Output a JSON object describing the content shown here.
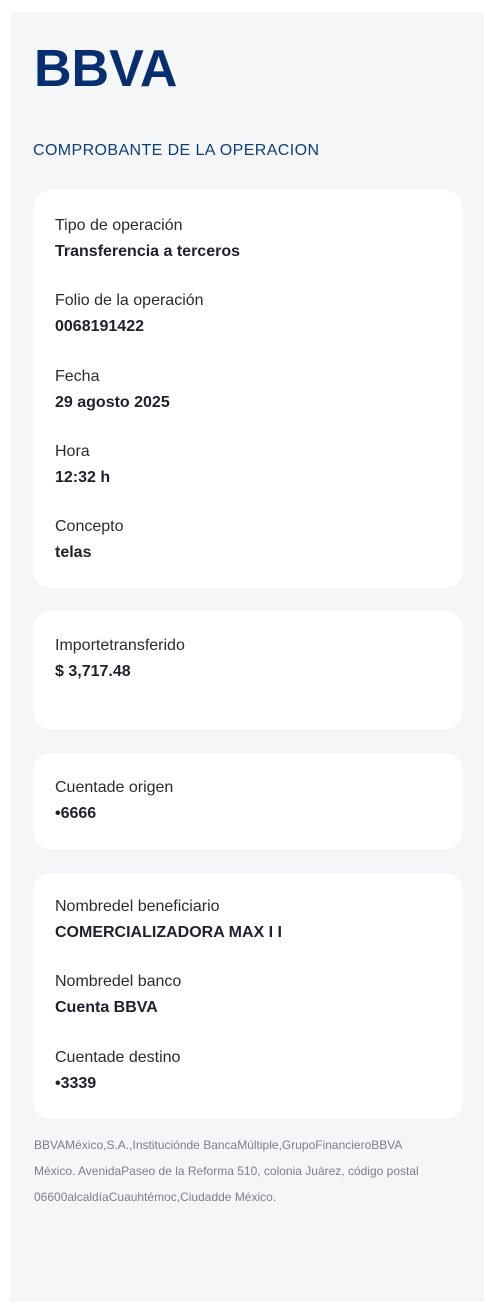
{
  "brand": {
    "logo_text": "BBVA",
    "color": "#072f6f"
  },
  "heading": "COMPROBANTE DE LA OPERACION",
  "card1": {
    "fields": [
      {
        "label": "Tipo de operación",
        "value": "Transferencia a terceros"
      },
      {
        "label": "Folio de la operación",
        "value": "0068191422"
      },
      {
        "label": "Fecha",
        "value": "29 agosto 2025"
      },
      {
        "label": "Hora",
        "value": "12:32 h"
      },
      {
        "label": "Concepto",
        "value": "telas"
      }
    ]
  },
  "card2": {
    "label": "Importetransferido",
    "value": "$ 3,717.48"
  },
  "card3": {
    "label": "Cuentade origen",
    "value": "•6666"
  },
  "card4": {
    "fields": [
      {
        "label": "Nombredel beneficiario",
        "value": "COMERCIALIZADORA MAX I I"
      },
      {
        "label": "Nombredel banco",
        "value": "Cuenta BBVA"
      },
      {
        "label": "Cuentade destino",
        "value": "•3339"
      }
    ]
  },
  "footer": {
    "line1": "BBVAMéxico,S.A.,Instituciónde BancaMúltiple,GrupoFinancieroBBVA",
    "line2": "México. AvenidaPaseo de la Reforma 510, colonia Juárez, código postal",
    "line3": "06600alcaldíaCuauhtémoc,Ciudadde México."
  }
}
